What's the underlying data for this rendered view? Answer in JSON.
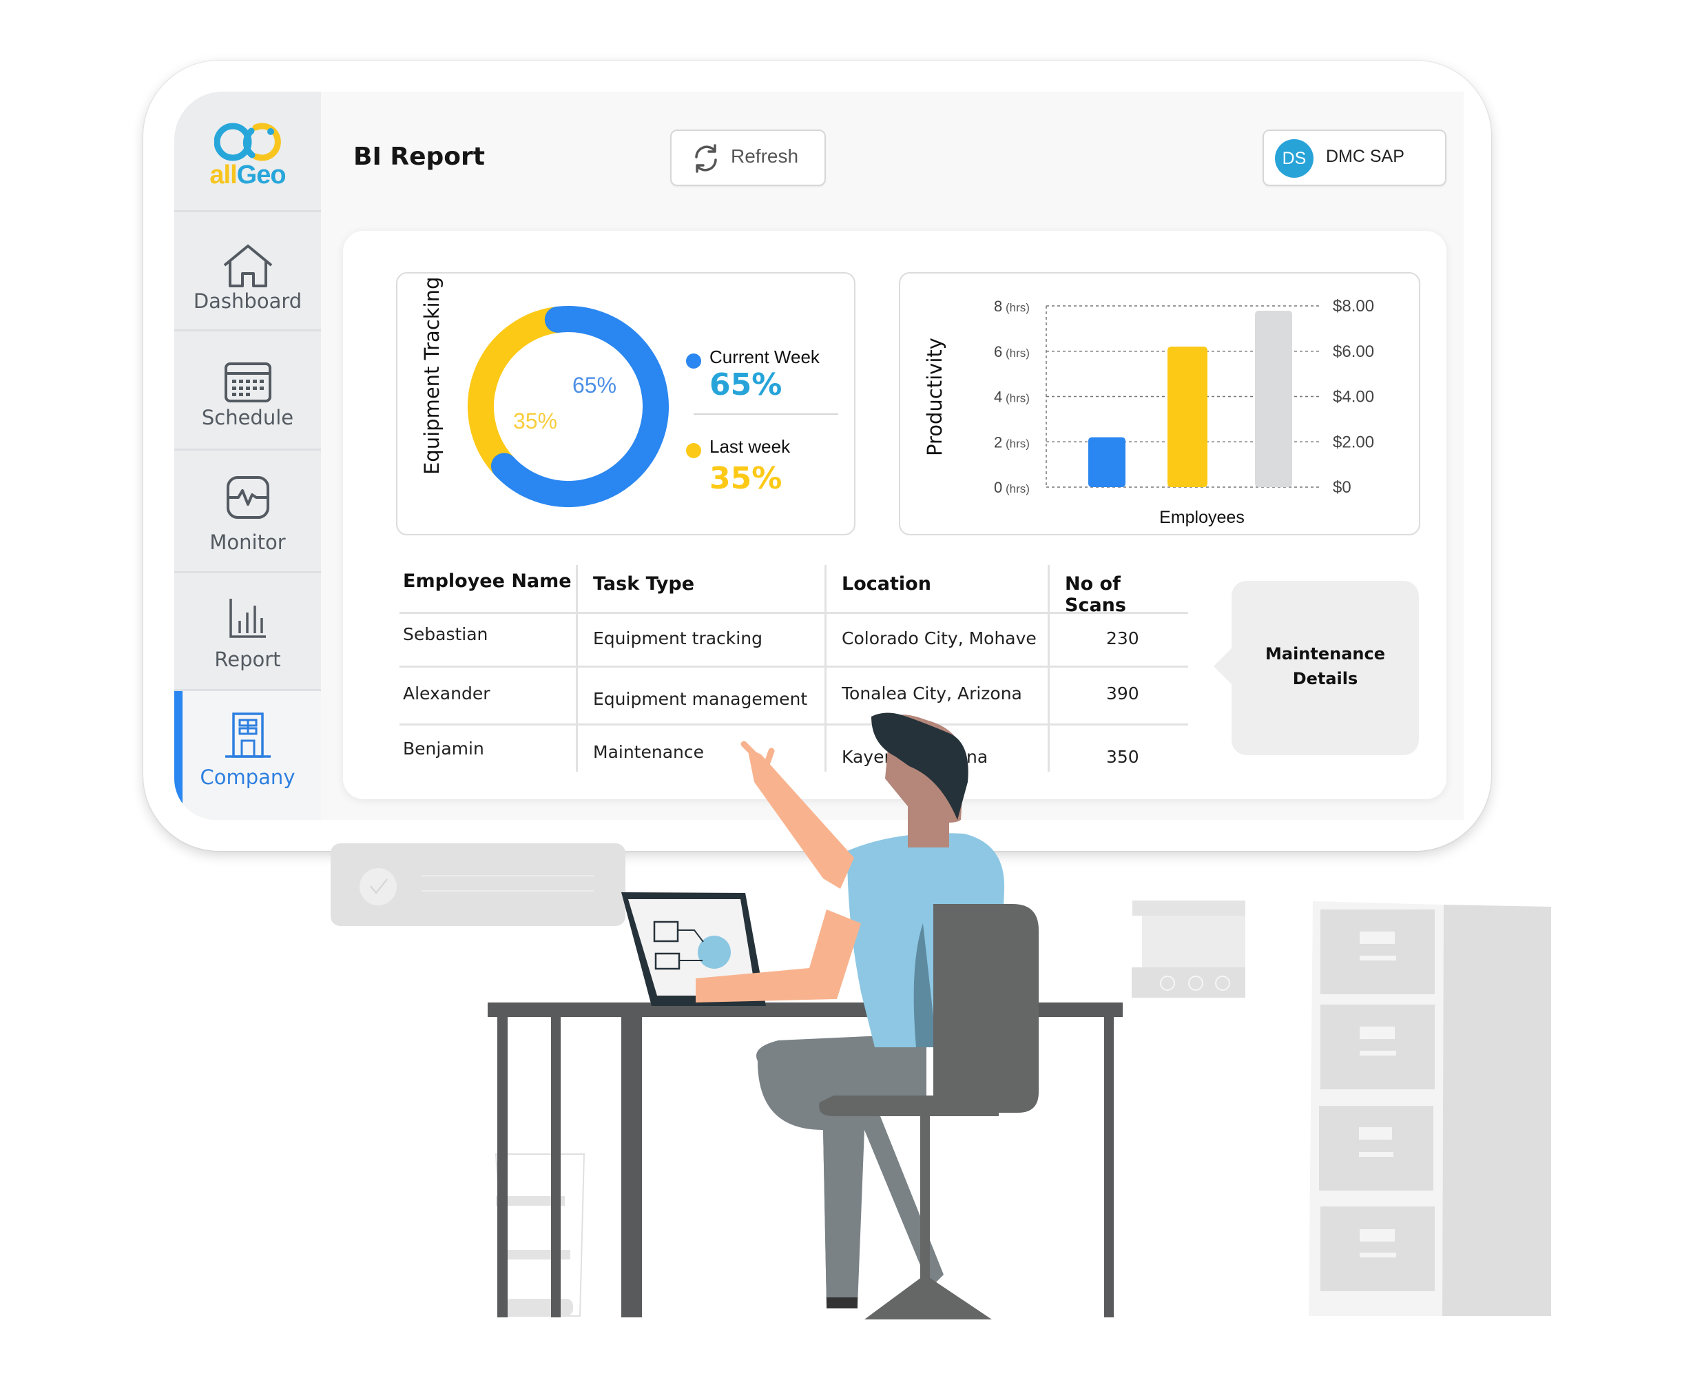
{
  "app": {
    "logo_text_a": "all",
    "logo_text_b": "Geo",
    "title": "BI Report"
  },
  "sidebar": {
    "items": [
      {
        "label": "Dashboard",
        "icon": "home-icon",
        "active": false
      },
      {
        "label": "Schedule",
        "icon": "calendar-icon",
        "active": false
      },
      {
        "label": "Monitor",
        "icon": "pulse-monitor-icon",
        "active": false
      },
      {
        "label": "Report",
        "icon": "bar-chart-icon",
        "active": false
      },
      {
        "label": "Company",
        "icon": "building-icon",
        "active": true
      }
    ]
  },
  "header": {
    "refresh_label": "Refresh",
    "user_initials": "DS",
    "user_name": "DMC SAP"
  },
  "colors": {
    "accent_blue": "#2a86f0",
    "accent_yellow": "#fdc917",
    "brand_cyan": "#27a6da",
    "bar_gray": "#d9dbdc"
  },
  "chart_data": [
    {
      "type": "pie",
      "title": "Equipment Tracking",
      "donut": true,
      "slices": [
        {
          "label": "Current Week",
          "value": 65,
          "display": "65%",
          "color": "#2a86f0"
        },
        {
          "label": "Last week",
          "value": 35,
          "display": "35%",
          "color": "#fdc917"
        }
      ],
      "legend_placement": "right"
    },
    {
      "type": "bar",
      "title": "",
      "ylabel": "Productivity",
      "xlabel": "Employees",
      "y_unit": "(hrs)",
      "ylim": [
        0,
        8
      ],
      "yticks": [
        0,
        2,
        4,
        6,
        8
      ],
      "ytick_labels": [
        "0",
        "2",
        "4",
        "6",
        "8"
      ],
      "y2_tick_labels": [
        "$0",
        "$2.00",
        "$4.00",
        "$6.00",
        "$8.00"
      ],
      "grid": true,
      "categories": [
        "",
        "",
        ""
      ],
      "values": [
        2.2,
        6.2,
        8.0
      ],
      "bar_colors": [
        "#2a86f0",
        "#fdc917",
        "#d9dbdc"
      ]
    }
  ],
  "table": {
    "columns": [
      "Employee Name",
      "Task Type",
      "Location",
      "No of Scans"
    ],
    "rows": [
      [
        "Sebastian",
        "Equipment tracking",
        "Colorado City, Mohave",
        "230"
      ],
      [
        "Alexander",
        "Equipment management",
        "Tonalea City, Arizona",
        "390"
      ],
      [
        "Benjamin",
        "Maintenance",
        "Kayenta, Arizona",
        "350"
      ]
    ]
  },
  "maintenance": {
    "line1": "Maintenance",
    "line2": "Details"
  }
}
